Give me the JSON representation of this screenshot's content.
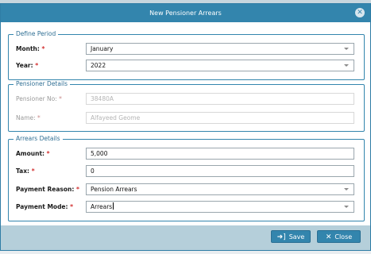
{
  "dialog": {
    "title": "New Pensioner Arrears",
    "close_glyph": "✕"
  },
  "define_period": {
    "legend": "Define Period",
    "month": {
      "label": "Month:",
      "required": "*",
      "value": "January"
    },
    "year": {
      "label": "Year:",
      "required": "*",
      "value": "2022"
    }
  },
  "pensioner_details": {
    "legend": "Pensioner Details",
    "pensioner_no": {
      "label": "Pensioner No:",
      "required": "*",
      "value": "38480A"
    },
    "name": {
      "label": "Name:",
      "required": "*",
      "value": "Alfayeed Geome"
    }
  },
  "arrears_details": {
    "legend": "Arrears Details",
    "amount": {
      "label": "Amount:",
      "required": "*",
      "value": "5,000"
    },
    "tax": {
      "label": "Tax:",
      "required": "*",
      "value": "0"
    },
    "payment_reason": {
      "label": "Payment Reason:",
      "required": "*",
      "value": "Pension Arrears"
    },
    "payment_mode": {
      "label": "Payment Mode:",
      "required": "*",
      "value": "Arrears"
    }
  },
  "footer": {
    "save_label": "Save",
    "save_icon": "sign-in-icon",
    "close_label": "Close",
    "close_icon": "close-x-icon"
  },
  "colors": {
    "accent": "#3385ad",
    "required": "#d32f2f",
    "footer_bg": "#b5cfda"
  }
}
